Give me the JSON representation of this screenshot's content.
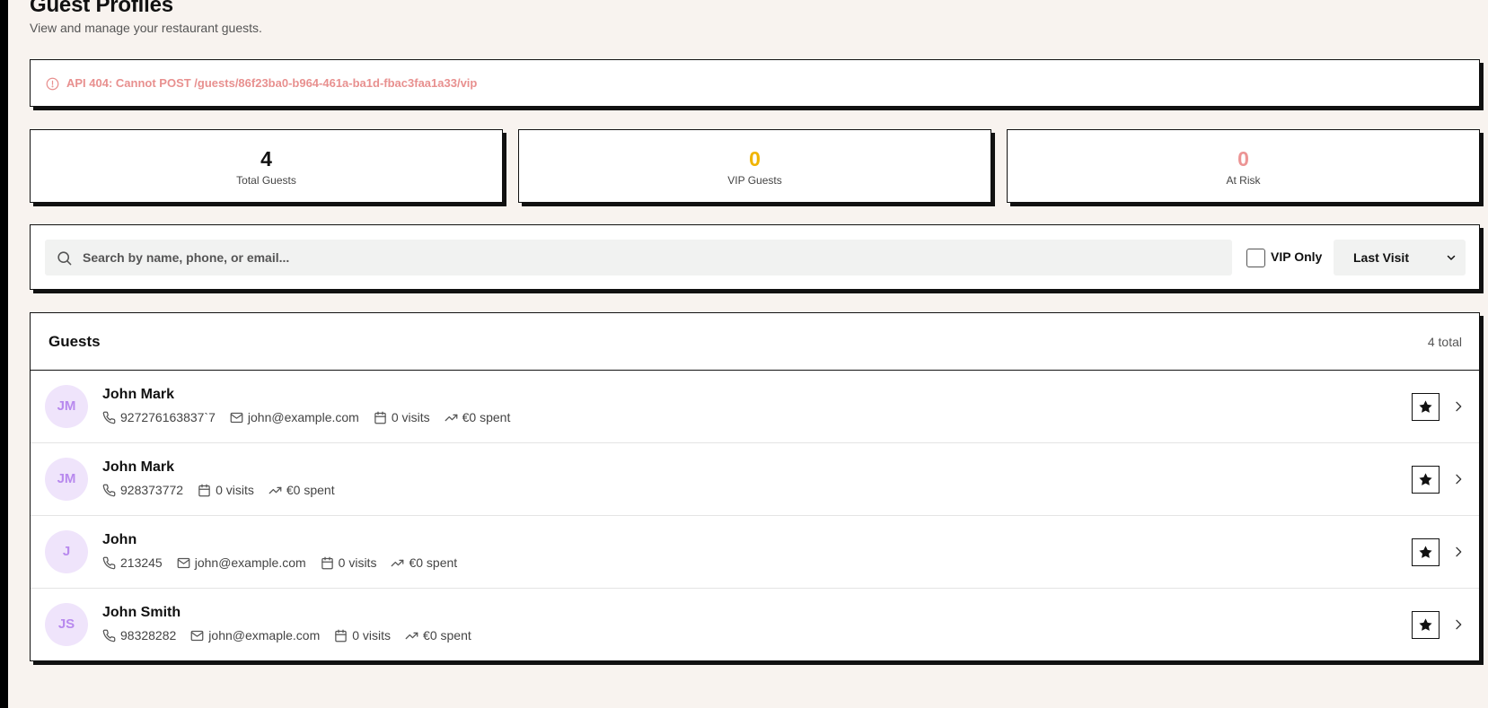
{
  "page": {
    "title": "Guest Profiles",
    "subtitle": "View and manage your restaurant guests."
  },
  "error": {
    "icon": "alert-circle-icon",
    "message": "API 404: Cannot POST /guests/86f23ba0-b964-461a-ba1d-fbac3faa1a33/vip",
    "color": "#e8908f"
  },
  "stats": [
    {
      "value": "4",
      "label": "Total Guests",
      "color": "#111111"
    },
    {
      "value": "0",
      "label": "VIP Guests",
      "color": "#f0b400"
    },
    {
      "value": "0",
      "label": "At Risk",
      "color": "#ec9494"
    }
  ],
  "filters": {
    "search_placeholder": "Search by name, phone, or email...",
    "search_value": "",
    "vip_only_label": "VIP Only",
    "vip_only_checked": false,
    "sort_selected": "Last Visit"
  },
  "guests": {
    "title": "Guests",
    "count_label": "4 total",
    "rows": [
      {
        "initials": "JM",
        "name": "John Mark",
        "phone": "927276163837`7",
        "email": "john@example.com",
        "visits": "0 visits",
        "spent": "€0 spent"
      },
      {
        "initials": "JM",
        "name": "John Mark",
        "phone": "928373772",
        "email": "",
        "visits": "0 visits",
        "spent": "€0 spent"
      },
      {
        "initials": "J",
        "name": "John",
        "phone": "213245",
        "email": "john@example.com",
        "visits": "0 visits",
        "spent": "€0 spent"
      },
      {
        "initials": "JS",
        "name": "John Smith",
        "phone": "98328282",
        "email": "john@exmaple.com",
        "visits": "0 visits",
        "spent": "€0 spent"
      }
    ]
  },
  "colors": {
    "background": "#f8f3ef",
    "avatar_bg": "#efe4fb",
    "avatar_text": "#b889ee"
  }
}
